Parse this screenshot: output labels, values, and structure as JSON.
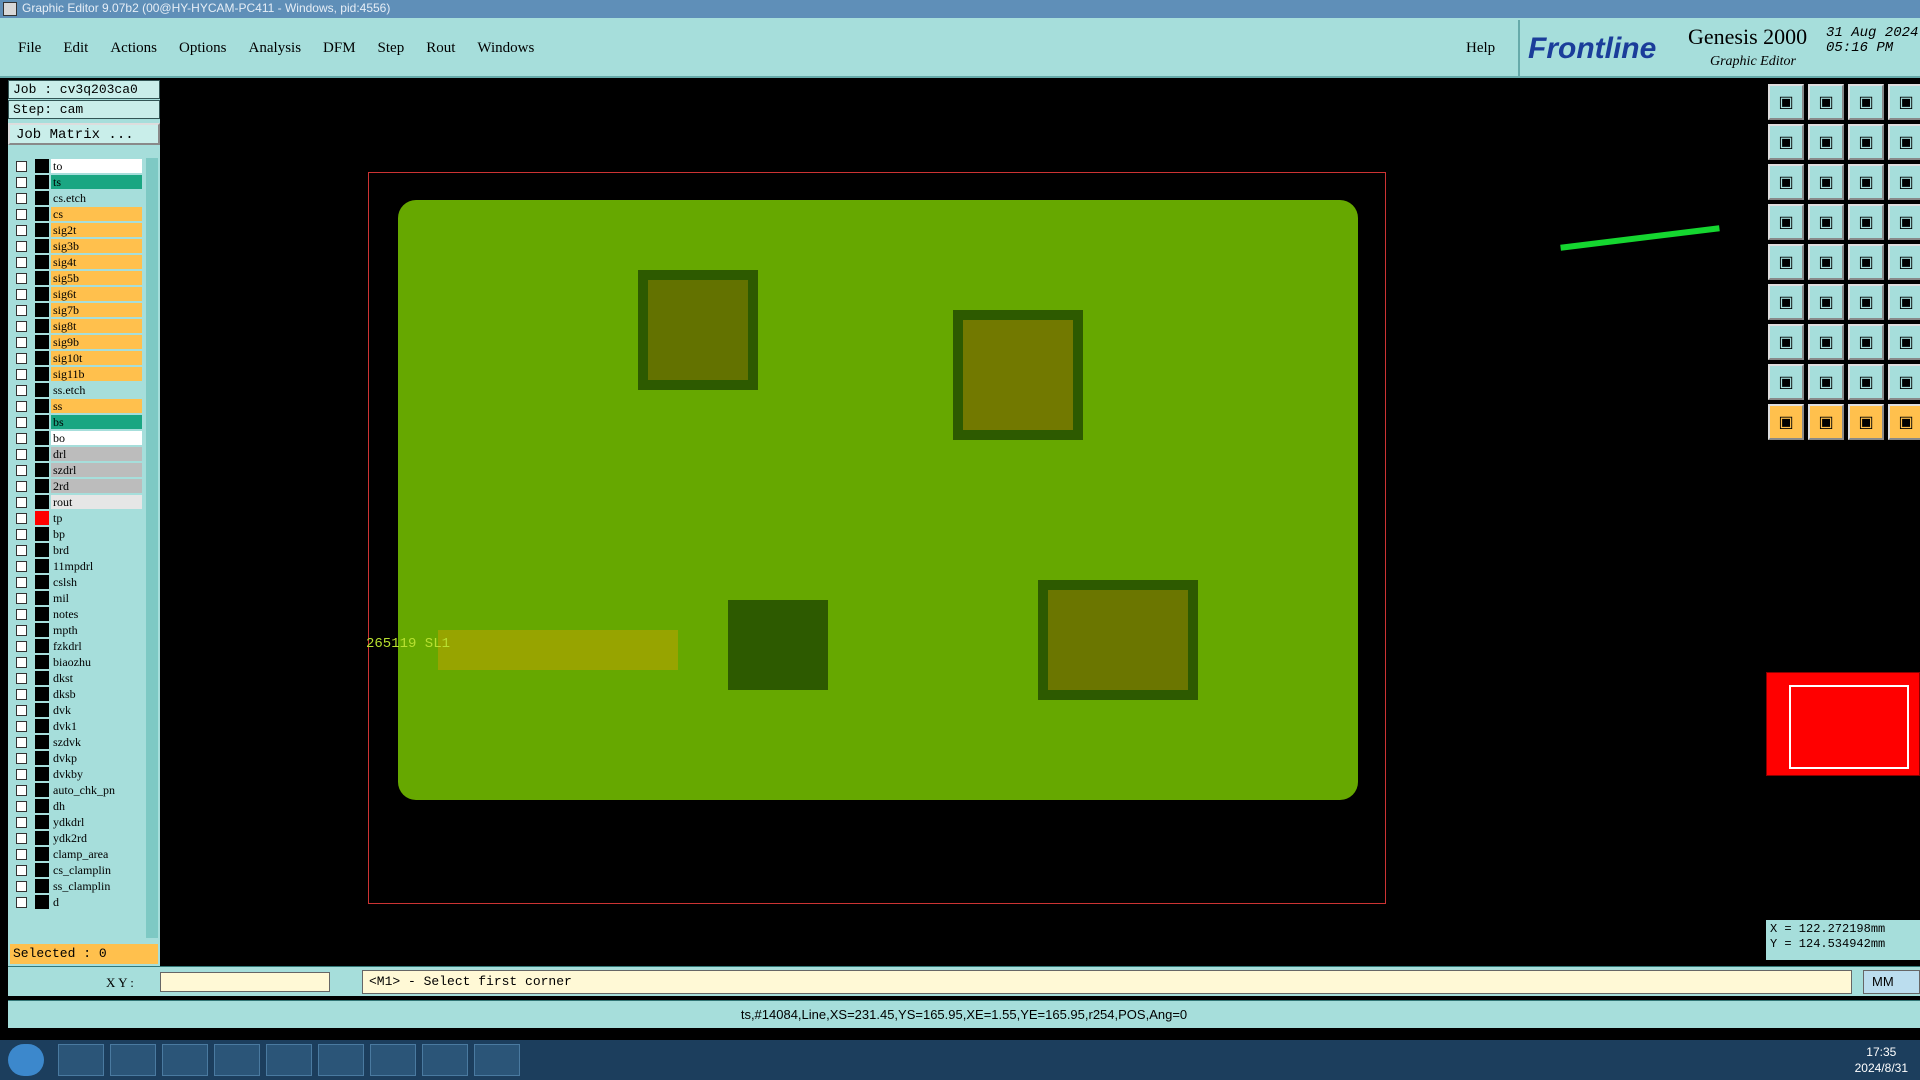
{
  "window_title": "Graphic Editor 9.07b2 (00@HY-HYCAM-PC411 - Windows, pid:4556)",
  "menu": [
    "File",
    "Edit",
    "Actions",
    "Options",
    "Analysis",
    "DFM",
    "Step",
    "Rout",
    "Windows"
  ],
  "help": "Help",
  "brand": {
    "frontline": "Frontline",
    "genesis": "Genesis 2000",
    "sub": "Graphic Editor",
    "date": "31 Aug 2024",
    "time": "05:16 PM"
  },
  "job": "Job : cv3q203ca0",
  "step": "Step: cam",
  "job_matrix": "Job Matrix ...",
  "layers": [
    [
      "to",
      "#ffffff"
    ],
    [
      "ts",
      "#1aa682"
    ],
    [
      "cs.etch",
      "#a6dedb"
    ],
    [
      "cs",
      "#ffc04d"
    ],
    [
      "sig2t",
      "#ffc04d"
    ],
    [
      "sig3b",
      "#ffc04d"
    ],
    [
      "sig4t",
      "#ffc04d"
    ],
    [
      "sig5b",
      "#ffc04d"
    ],
    [
      "sig6t",
      "#ffc04d"
    ],
    [
      "sig7b",
      "#ffc04d"
    ],
    [
      "sig8t",
      "#ffc04d"
    ],
    [
      "sig9b",
      "#ffc04d"
    ],
    [
      "sig10t",
      "#ffc04d"
    ],
    [
      "sig11b",
      "#ffc04d"
    ],
    [
      "ss.etch",
      "#a6dedb"
    ],
    [
      "ss",
      "#ffc04d"
    ],
    [
      "bs",
      "#1aa682"
    ],
    [
      "bo",
      "#ffffff"
    ],
    [
      "drl",
      "#bcbcbc"
    ],
    [
      "szdrl",
      "#bcbcbc"
    ],
    [
      "2rd",
      "#bcbcbc"
    ],
    [
      "rout",
      "#e6e6e6"
    ],
    [
      "tp",
      "#a6dedb"
    ],
    [
      "bp",
      "#a6dedb"
    ],
    [
      "brd",
      "#a6dedb"
    ],
    [
      "11mpdrl",
      "#a6dedb"
    ],
    [
      "cslsh",
      "#a6dedb"
    ],
    [
      "mil",
      "#a6dedb"
    ],
    [
      "notes",
      "#a6dedb"
    ],
    [
      "mpth",
      "#a6dedb"
    ],
    [
      "fzkdrl",
      "#a6dedb"
    ],
    [
      "biaozhu",
      "#a6dedb"
    ],
    [
      "dkst",
      "#a6dedb"
    ],
    [
      "dksb",
      "#a6dedb"
    ],
    [
      "dvk",
      "#a6dedb"
    ],
    [
      "dvk1",
      "#a6dedb"
    ],
    [
      "szdvk",
      "#a6dedb"
    ],
    [
      "dvkp",
      "#a6dedb"
    ],
    [
      "dvkby",
      "#a6dedb"
    ],
    [
      "auto_chk_pn",
      "#a6dedb"
    ],
    [
      "dh",
      "#a6dedb"
    ],
    [
      "ydkdrl",
      "#a6dedb"
    ],
    [
      "ydk2rd",
      "#a6dedb"
    ],
    [
      "clamp_area",
      "#a6dedb"
    ],
    [
      "cs_clamplin",
      "#a6dedb"
    ],
    [
      "ss_clamplin",
      "#a6dedb"
    ],
    [
      "d",
      "#a6dedb"
    ]
  ],
  "selected": "Selected : 0",
  "board_label": "265119   SL1",
  "xy_label": "X Y :",
  "prompt": "<M1> - Select first corner",
  "units": "MM",
  "coords": {
    "x": "X = 122.272198mm",
    "y": "Y = 124.534942mm"
  },
  "status": "ts,#14084,Line,XS=231.45,YS=165.95,XE=1.55,YE=165.95,r254,POS,Ang=0",
  "clock": {
    "time": "17:35",
    "date": "2024/8/31"
  }
}
